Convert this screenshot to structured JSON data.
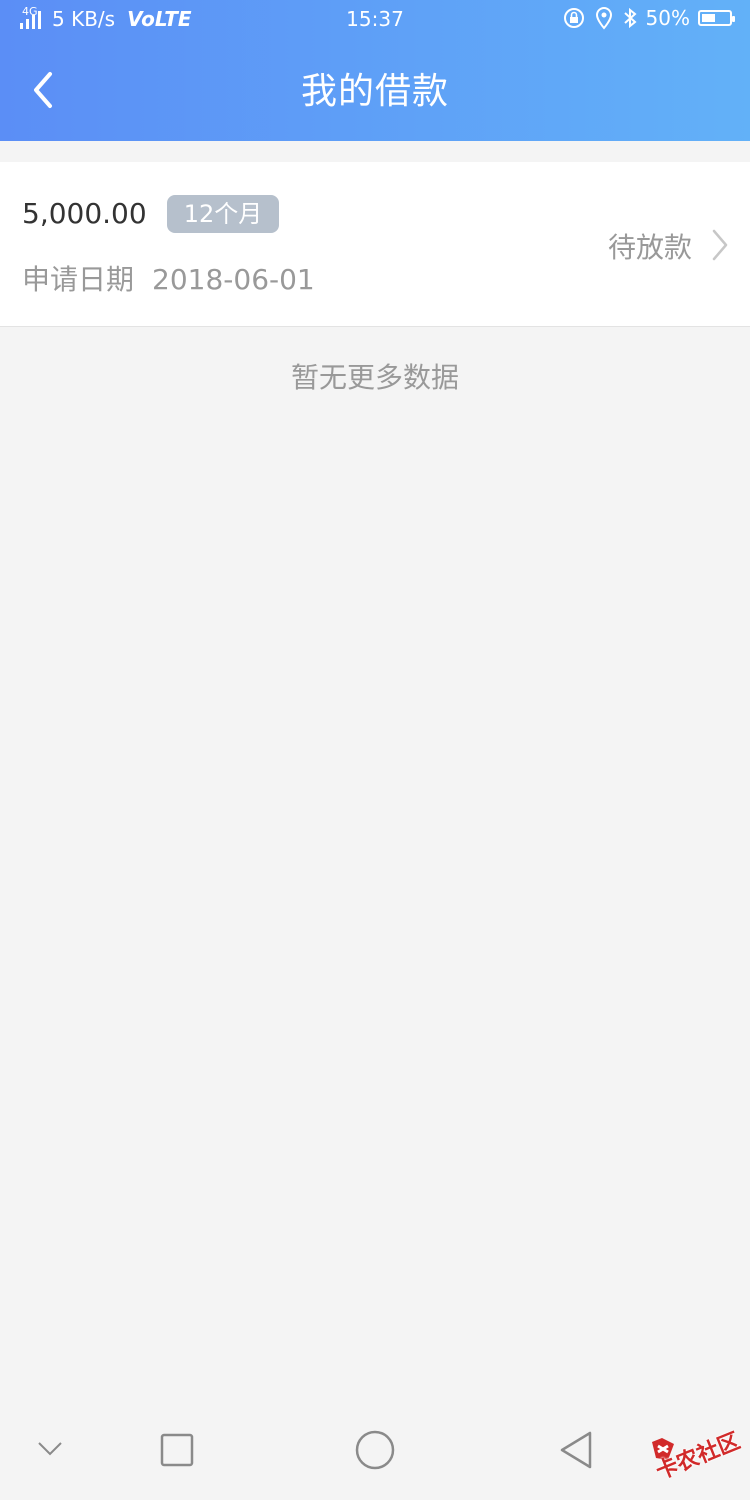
{
  "status_bar": {
    "network": "4G",
    "speed": "5 KB/s",
    "volte": "VoLTE",
    "time": "15:37",
    "battery_percent": "50%",
    "battery_level": 0.5
  },
  "header": {
    "title": "我的借款",
    "background_start": "#5b8ef6",
    "background_end": "#62b1f8"
  },
  "loan": {
    "amount": "5,000.00",
    "term": "12个月",
    "date_label": "申请日期",
    "date_value": "2018-06-01",
    "status": "待放款"
  },
  "list_footer": "暂无更多数据",
  "watermark": "卡农社区",
  "system_nav": {
    "icons": [
      "chevron-down-icon",
      "square-icon",
      "circle-icon",
      "triangle-back-icon"
    ]
  }
}
